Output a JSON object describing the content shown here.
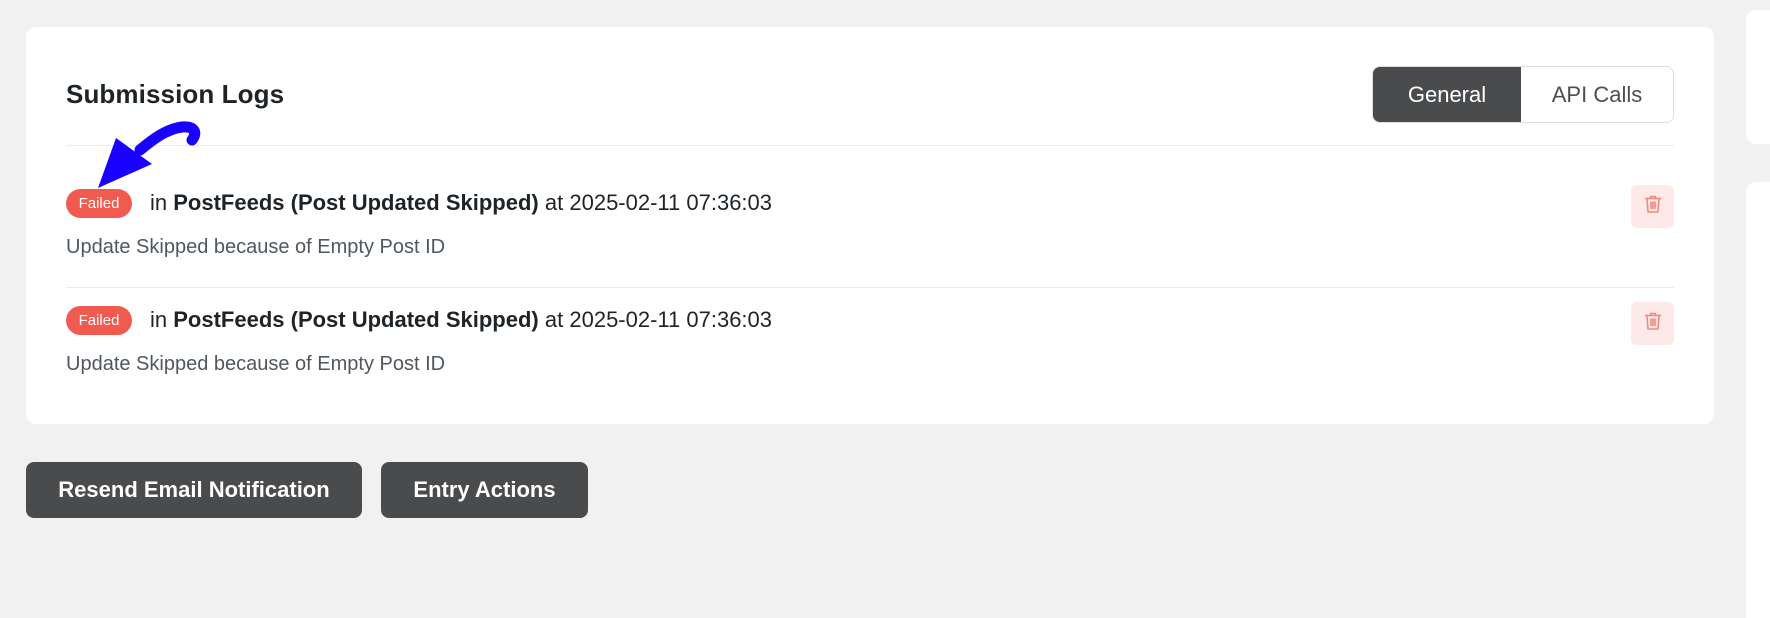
{
  "logs_card": {
    "title": "Submission Logs",
    "tabs": [
      {
        "label": "General",
        "active": true
      },
      {
        "label": "API Calls",
        "active": false
      }
    ],
    "entries": [
      {
        "status": "Failed",
        "prefix": "in",
        "feed": "PostFeeds (Post Updated Skipped)",
        "at_label": "at",
        "timestamp": "2025-02-11 07:36:03",
        "description": "Update Skipped because of Empty Post ID"
      },
      {
        "status": "Failed",
        "prefix": "in",
        "feed": "PostFeeds (Post Updated Skipped)",
        "at_label": "at",
        "timestamp": "2025-02-11 07:36:03",
        "description": "Update Skipped because of Empty Post ID"
      }
    ]
  },
  "actions": {
    "resend_label": "Resend Email Notification",
    "entry_actions_label": "Entry Actions"
  },
  "icons": {
    "delete": "trash-icon",
    "annotation": "arrow-annotation"
  },
  "colors": {
    "accent_dark": "#4a4b4d",
    "badge_failed": "#f05a4f",
    "delete_bg": "#fde9e7",
    "delete_icon": "#f08a80",
    "annotation": "#1a00ff"
  }
}
